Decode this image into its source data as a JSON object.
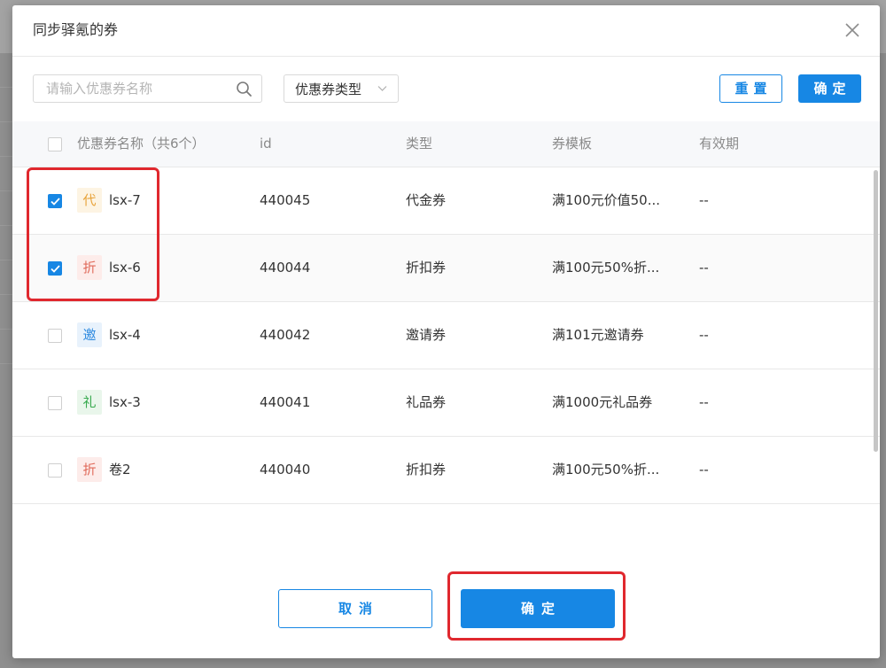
{
  "modal": {
    "title": "同步驿氪的券"
  },
  "toolbar": {
    "search_placeholder": "请输入优惠券名称",
    "type_select_label": "优惠券类型",
    "reset_label": "重置",
    "confirm_label": "确定"
  },
  "table": {
    "columns": [
      "优惠券名称（共6个）",
      "id",
      "类型",
      "券模板",
      "有效期"
    ],
    "rows": [
      {
        "checked": true,
        "tag": "代",
        "tag_color": "#e8a33a",
        "tag_bg": "#fdf4e3",
        "name": "lsx-7",
        "id": "440045",
        "type": "代金券",
        "template": "满100元价值50...",
        "validity": "--"
      },
      {
        "checked": true,
        "tag": "折",
        "tag_color": "#e06a5a",
        "tag_bg": "#fdecea",
        "name": "lsx-6",
        "id": "440044",
        "type": "折扣券",
        "template": "满100元50%折...",
        "validity": "--"
      },
      {
        "checked": false,
        "tag": "邀",
        "tag_color": "#2f8be0",
        "tag_bg": "#e8f2fc",
        "name": "lsx-4",
        "id": "440042",
        "type": "邀请券",
        "template": "满101元邀请券",
        "validity": "--"
      },
      {
        "checked": false,
        "tag": "礼",
        "tag_color": "#36a94d",
        "tag_bg": "#e9f6eb",
        "name": "lsx-3",
        "id": "440041",
        "type": "礼品券",
        "template": "满1000元礼品券",
        "validity": "--"
      },
      {
        "checked": false,
        "tag": "折",
        "tag_color": "#e06a5a",
        "tag_bg": "#fdecea",
        "name": "卷2",
        "id": "440040",
        "type": "折扣券",
        "template": "满100元50%折...",
        "validity": "--"
      }
    ]
  },
  "footer": {
    "cancel_label": "取消",
    "confirm_label": "确定"
  },
  "colors": {
    "primary": "#1787e4",
    "highlight": "#e0282e"
  }
}
